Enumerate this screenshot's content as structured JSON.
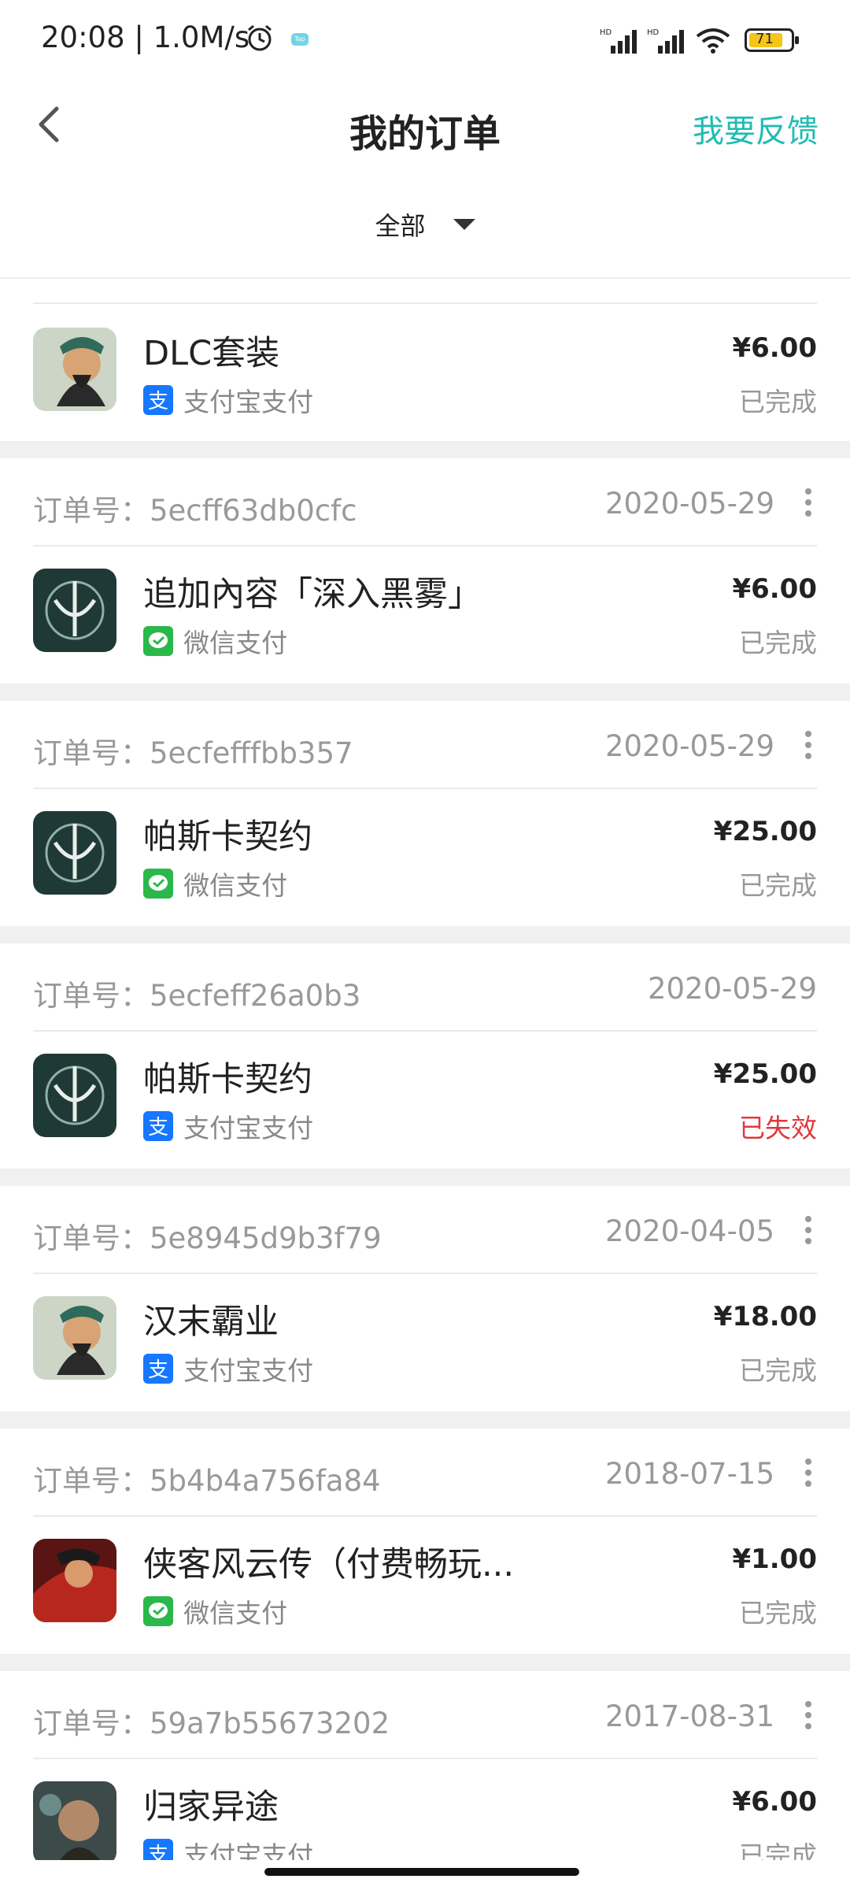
{
  "status_bar": {
    "time": "20:08 | 1.0M/s",
    "battery": "71",
    "tap_label": "Tap"
  },
  "header": {
    "title": "我的订单",
    "feedback": "我要反馈"
  },
  "filter": {
    "label": "全部"
  },
  "orders": [
    {
      "order_no": "",
      "date": "",
      "name": "DLC套装",
      "pay": "支付宝支付",
      "pay_type": "alipay",
      "price": "¥6.00",
      "status": "已完成",
      "thumb": "hanmo"
    },
    {
      "order_no": "订单号：5ecff63db0cfc",
      "date": "2020-05-29",
      "name": "追加內容「深入黑雾」",
      "pay": "微信支付",
      "pay_type": "wechat",
      "price": "¥6.00",
      "status": "已完成",
      "thumb": "emblem"
    },
    {
      "order_no": "订单号：5ecfefffbb357",
      "date": "2020-05-29",
      "name": "帕斯卡契约",
      "pay": "微信支付",
      "pay_type": "wechat",
      "price": "¥25.00",
      "status": "已完成",
      "thumb": "emblem"
    },
    {
      "order_no": "订单号：5ecfeff26a0b3",
      "date": "2020-05-29",
      "name": "帕斯卡契约",
      "pay": "支付宝支付",
      "pay_type": "alipay",
      "price": "¥25.00",
      "status": "已失效",
      "thumb": "emblem"
    },
    {
      "order_no": "订单号：5e8945d9b3f79",
      "date": "2020-04-05",
      "name": "汉末霸业",
      "pay": "支付宝支付",
      "pay_type": "alipay",
      "price": "¥18.00",
      "status": "已完成",
      "thumb": "hanmo"
    },
    {
      "order_no": "订单号：5b4b4a756fa84",
      "date": "2018-07-15",
      "name": "侠客风云传（付费畅玩...",
      "pay": "微信支付",
      "pay_type": "wechat",
      "price": "¥1.00",
      "status": "已完成",
      "thumb": "xiake"
    },
    {
      "order_no": "订单号：59a7b55673202",
      "date": "2017-08-31",
      "name": "归家异途",
      "pay": "支付宝支付",
      "pay_type": "alipay",
      "price": "¥6.00",
      "status": "已完成",
      "thumb": "guijia"
    }
  ],
  "colors": {
    "accent": "#1fbcb4",
    "failed": "#e0393e",
    "alipay": "#1677ff",
    "wechat": "#2ab84a"
  }
}
